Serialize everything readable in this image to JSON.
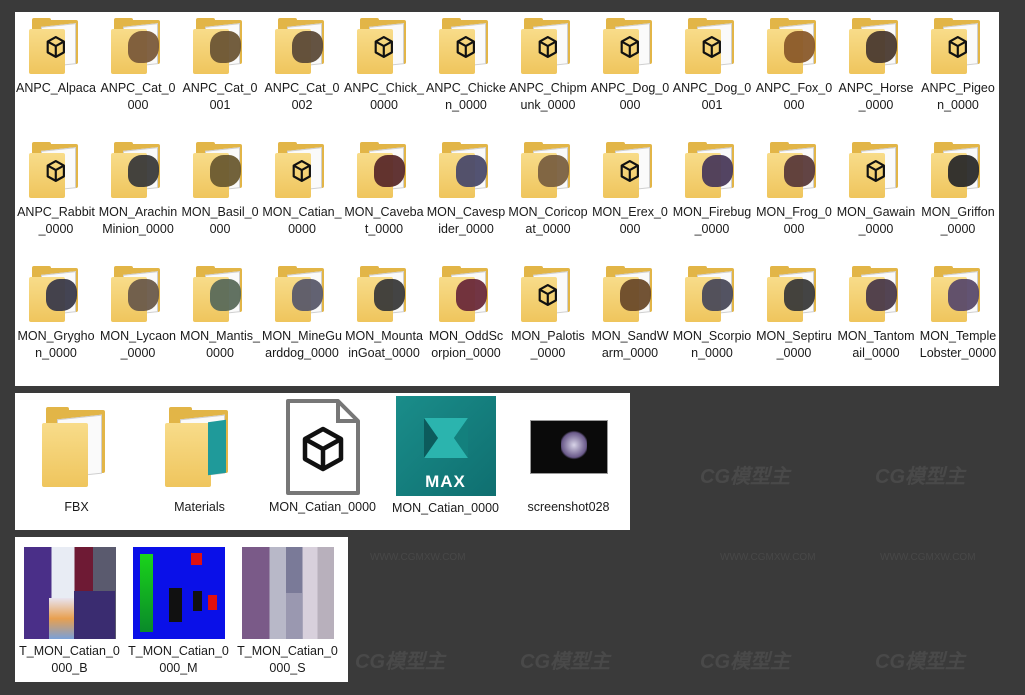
{
  "watermark": {
    "brand": "CG模型主",
    "site": "WWW.CGMXW.COM"
  },
  "folders_top": [
    {
      "label": "ANPC_Alpaca",
      "thumb": "fbx-icon"
    },
    {
      "label": "ANPC_Cat_0000",
      "thumb": "creature",
      "color": "#7a5a3a"
    },
    {
      "label": "ANPC_Cat_0001",
      "thumb": "creature",
      "color": "#6b5535"
    },
    {
      "label": "ANPC_Cat_0002",
      "thumb": "creature",
      "color": "#5c4a38"
    },
    {
      "label": "ANPC_Chick_0000",
      "thumb": "fbx-icon"
    },
    {
      "label": "ANPC_Chicken_0000",
      "thumb": "fbx-icon"
    },
    {
      "label": "ANPC_Chipmunk_0000",
      "thumb": "fbx-icon"
    },
    {
      "label": "ANPC_Dog_0000",
      "thumb": "fbx-icon"
    },
    {
      "label": "ANPC_Dog_0001",
      "thumb": "fbx-icon"
    },
    {
      "label": "ANPC_Fox_0000",
      "thumb": "creature",
      "color": "#8a5a2a"
    },
    {
      "label": "ANPC_Horse_0000",
      "thumb": "creature",
      "color": "#4a3a30"
    },
    {
      "label": "ANPC_Pigeon_0000",
      "thumb": "fbx-icon"
    },
    {
      "label": "ANPC_Rabbit_0000",
      "thumb": "fbx-icon"
    },
    {
      "label": "MON_ArachinMinion_0000",
      "thumb": "creature",
      "color": "#3a3a3a"
    },
    {
      "label": "MON_Basil_0000",
      "thumb": "creature",
      "color": "#6a5a30"
    },
    {
      "label": "MON_Catian_0000",
      "thumb": "fbx-icon"
    },
    {
      "label": "MON_Cavebat_0000",
      "thumb": "creature",
      "color": "#5a2a2a"
    },
    {
      "label": "MON_Cavespider_0000",
      "thumb": "creature",
      "color": "#4a4a6a"
    },
    {
      "label": "MON_Coricopat_0000",
      "thumb": "creature",
      "color": "#7a6040"
    },
    {
      "label": "MON_Erex_0000",
      "thumb": "fbx-icon"
    },
    {
      "label": "MON_Firebug_0000",
      "thumb": "creature",
      "color": "#4a3a5a"
    },
    {
      "label": "MON_Frog_0000",
      "thumb": "creature",
      "color": "#5a3a3a"
    },
    {
      "label": "MON_Gawain_0000",
      "thumb": "fbx-icon"
    },
    {
      "label": "MON_Griffon_0000",
      "thumb": "creature",
      "color": "#2a2a2a"
    },
    {
      "label": "MON_Gryghon_0000",
      "thumb": "creature",
      "color": "#3a3a4a"
    },
    {
      "label": "MON_Lycaon_0000",
      "thumb": "creature",
      "color": "#6a5a4a"
    },
    {
      "label": "MON_Mantis_0000",
      "thumb": "creature",
      "color": "#5a6a5a"
    },
    {
      "label": "MON_MineGuarddog_0000",
      "thumb": "creature",
      "color": "#5a5a6a"
    },
    {
      "label": "MON_MountainGoat_0000",
      "thumb": "creature",
      "color": "#3a3a3a"
    },
    {
      "label": "MON_OddScorpion_0000",
      "thumb": "creature",
      "color": "#6a2a3a"
    },
    {
      "label": "MON_Palotis_0000",
      "thumb": "fbx-icon"
    },
    {
      "label": "MON_SandWarm_0000",
      "thumb": "creature",
      "color": "#6a4a2a"
    },
    {
      "label": "MON_Scorpion_0000",
      "thumb": "creature",
      "color": "#4a4a5a"
    },
    {
      "label": "MON_Septiru_0000",
      "thumb": "creature",
      "color": "#3a3a3a"
    },
    {
      "label": "MON_Tantomail_0000",
      "thumb": "creature",
      "color": "#4a3a4a"
    },
    {
      "label": "MON_TempleLobster_0000",
      "thumb": "creature",
      "color": "#5a4a6a"
    }
  ],
  "files_mid": [
    {
      "label": "FBX",
      "type": "folder"
    },
    {
      "label": "Materials",
      "type": "folder-teal"
    },
    {
      "label": "MON_Catian_0000",
      "type": "fbx-file"
    },
    {
      "label": "MON_Catian_0000",
      "type": "max-file",
      "badge": "MAX"
    },
    {
      "label": "screenshot028",
      "type": "image"
    }
  ],
  "textures": [
    {
      "label": "T_MON_Catian_0000_B",
      "type": "tex-b"
    },
    {
      "label": "T_MON_Catian_0000_M",
      "type": "tex-m"
    },
    {
      "label": "T_MON_Catian_0000_S",
      "type": "tex-s"
    }
  ]
}
